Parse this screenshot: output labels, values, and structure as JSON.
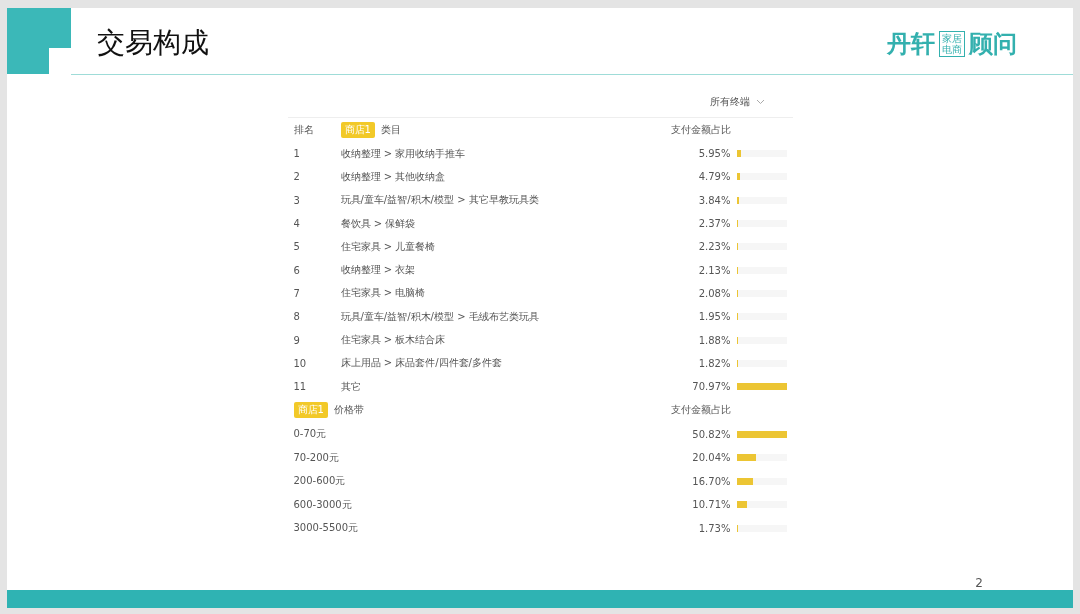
{
  "slide": {
    "title": "交易构成",
    "page_number": "2"
  },
  "logo": {
    "name_left": "丹轩",
    "tag_lines": [
      "家居",
      "电商"
    ],
    "name_right": "顾问"
  },
  "filter": {
    "label": "所有终端"
  },
  "category_table": {
    "columns": [
      "排名",
      "类目",
      "支付金额占比"
    ],
    "badge": "商店1",
    "rows": [
      {
        "rank": "1",
        "category": "收纳整理 > 家用收纳手推车",
        "share": "5.95%",
        "level": 0.084
      },
      {
        "rank": "2",
        "category": "收纳整理 > 其他收纳盒",
        "share": "4.79%",
        "level": 0.067
      },
      {
        "rank": "3",
        "category": "玩具/童车/益智/积木/模型 > 其它早教玩具类",
        "share": "3.84%",
        "level": 0.054
      },
      {
        "rank": "4",
        "category": "餐饮具 > 保鲜袋",
        "share": "2.37%",
        "level": 0.033
      },
      {
        "rank": "5",
        "category": "住宅家具 > 儿童餐椅",
        "share": "2.23%",
        "level": 0.031
      },
      {
        "rank": "6",
        "category": "收纳整理 > 衣架",
        "share": "2.13%",
        "level": 0.03
      },
      {
        "rank": "7",
        "category": "住宅家具 > 电脑椅",
        "share": "2.08%",
        "level": 0.029
      },
      {
        "rank": "8",
        "category": "玩具/童车/益智/积木/模型 > 毛绒布艺类玩具",
        "share": "1.95%",
        "level": 0.027
      },
      {
        "rank": "9",
        "category": "住宅家具 > 板木结合床",
        "share": "1.88%",
        "level": 0.026
      },
      {
        "rank": "10",
        "category": "床上用品 > 床品套件/四件套/多件套",
        "share": "1.82%",
        "level": 0.026
      },
      {
        "rank": "11",
        "category": "其它",
        "share": "70.97%",
        "level": 1.0
      }
    ]
  },
  "price_table": {
    "columns": [
      "价格带",
      "支付金额占比"
    ],
    "badge": "商店1",
    "rows": [
      {
        "range": "0-70元",
        "share": "50.82%",
        "level": 1.0
      },
      {
        "range": "70-200元",
        "share": "20.04%",
        "level": 0.39
      },
      {
        "range": "200-600元",
        "share": "16.70%",
        "level": 0.33
      },
      {
        "range": "600-3000元",
        "share": "10.71%",
        "level": 0.21
      },
      {
        "range": "3000-5500元",
        "share": "1.73%",
        "level": 0.034
      }
    ]
  }
}
